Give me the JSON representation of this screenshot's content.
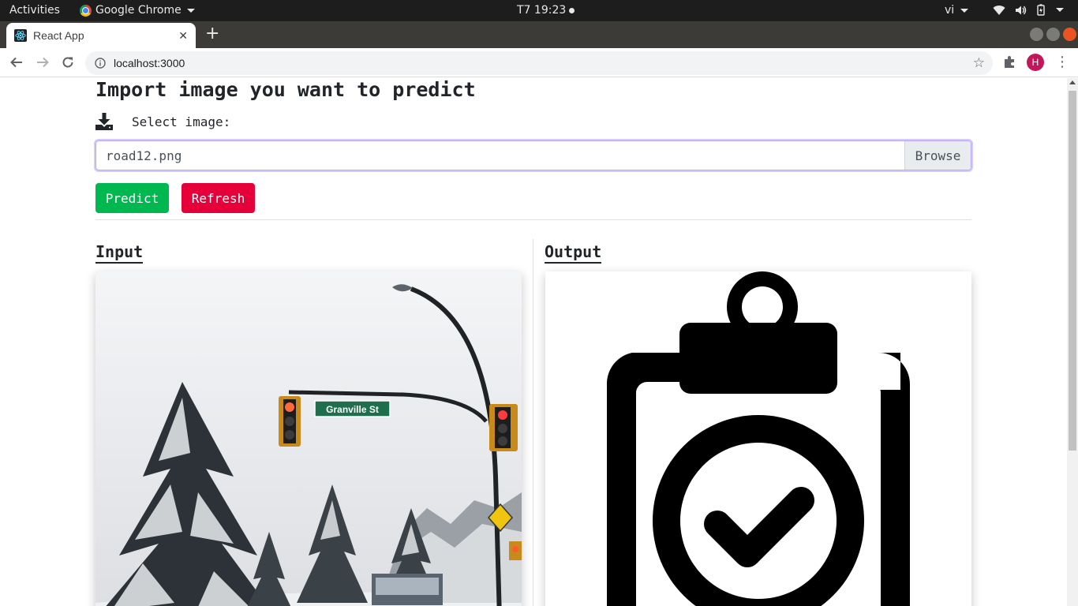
{
  "system_bar": {
    "activities": "Activities",
    "app_name": "Google Chrome",
    "clock": "T7 19:23",
    "language": "vi"
  },
  "browser": {
    "tab_title": "React App",
    "url": "localhost:3000",
    "profile_initial": "H"
  },
  "page": {
    "title": "Import image you want to predict",
    "select_label": "Select image:",
    "file_name": "road12.png",
    "browse_label": "Browse",
    "predict_label": "Predict",
    "refresh_label": "Refresh",
    "input_heading": "Input",
    "output_heading": "Output",
    "input_image": {
      "street_sign": "Granville St"
    },
    "output_icon": "clipboard-check-icon"
  },
  "colors": {
    "predict": "#00b84f",
    "refresh": "#e5003a",
    "focus_ring": "#b9a6f5"
  }
}
